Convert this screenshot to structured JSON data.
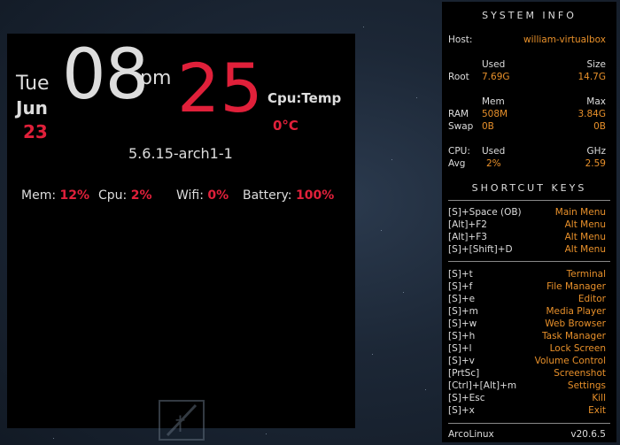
{
  "clock": {
    "day": "Tue",
    "month": "Jun",
    "date": "23",
    "hour": "08",
    "ampm": "pm",
    "minute": "25",
    "cpu_temp_label": "Cpu:Temp",
    "cpu_temp_value": "0°C",
    "kernel": "5.6.15-arch1-1",
    "stats": {
      "mem_label": "Mem:",
      "mem_value": "12%",
      "cpu_label": "Cpu:",
      "cpu_value": "2%",
      "wifi_label": "Wifi:",
      "wifi_value": "0%",
      "battery_label": "Battery:",
      "battery_value": "100%"
    }
  },
  "system_info": {
    "title": "SYSTEM INFO",
    "host_label": "Host:",
    "host_value": "william-virtualbox",
    "disk": {
      "used_header": "Used",
      "size_header": "Size",
      "root_label": "Root",
      "root_used": "7.69G",
      "root_size": "14.7G"
    },
    "memory": {
      "mem_header": "Mem",
      "max_header": "Max",
      "ram_label": "RAM",
      "ram_used": "508M",
      "ram_max": "3.84G",
      "swap_label": "Swap",
      "swap_used": "0B",
      "swap_max": "0B"
    },
    "cpu": {
      "cpu_label": "CPU:",
      "used_header": "Used",
      "ghz_header": "GHz",
      "avg_label": "Avg",
      "avg_used": "2%",
      "avg_ghz": "2.59"
    }
  },
  "shortcuts": {
    "title": "SHORTCUT KEYS",
    "group1": [
      {
        "key": "[S]+Space (OB)",
        "action": "Main Menu"
      },
      {
        "key": "[Alt]+F2",
        "action": "Alt Menu"
      },
      {
        "key": "[Alt]+F3",
        "action": "Alt Menu"
      },
      {
        "key": "[S]+[Shift]+D",
        "action": "Alt Menu"
      }
    ],
    "group2": [
      {
        "key": "[S]+t",
        "action": "Terminal"
      },
      {
        "key": "[S]+f",
        "action": "File Manager"
      },
      {
        "key": "[S]+e",
        "action": "Editor"
      },
      {
        "key": "[S]+m",
        "action": "Media Player"
      },
      {
        "key": "[S]+w",
        "action": "Web Browser"
      },
      {
        "key": "[S]+h",
        "action": "Task Manager"
      },
      {
        "key": "[S]+l",
        "action": "Lock Screen"
      },
      {
        "key": "[S]+v",
        "action": "Volume Control"
      },
      {
        "key": "[PrtSc]",
        "action": "Screenshot"
      },
      {
        "key": "[Ctrl]+[Alt]+m",
        "action": "Settings"
      },
      {
        "key": "[S]+Esc",
        "action": "Kill"
      },
      {
        "key": "[S]+x",
        "action": "Exit"
      }
    ]
  },
  "footer": {
    "distro": "ArcoLinux",
    "version": "v20.6.5"
  },
  "desktop": {
    "logo_icon": "arcolinux-logo-icon"
  }
}
